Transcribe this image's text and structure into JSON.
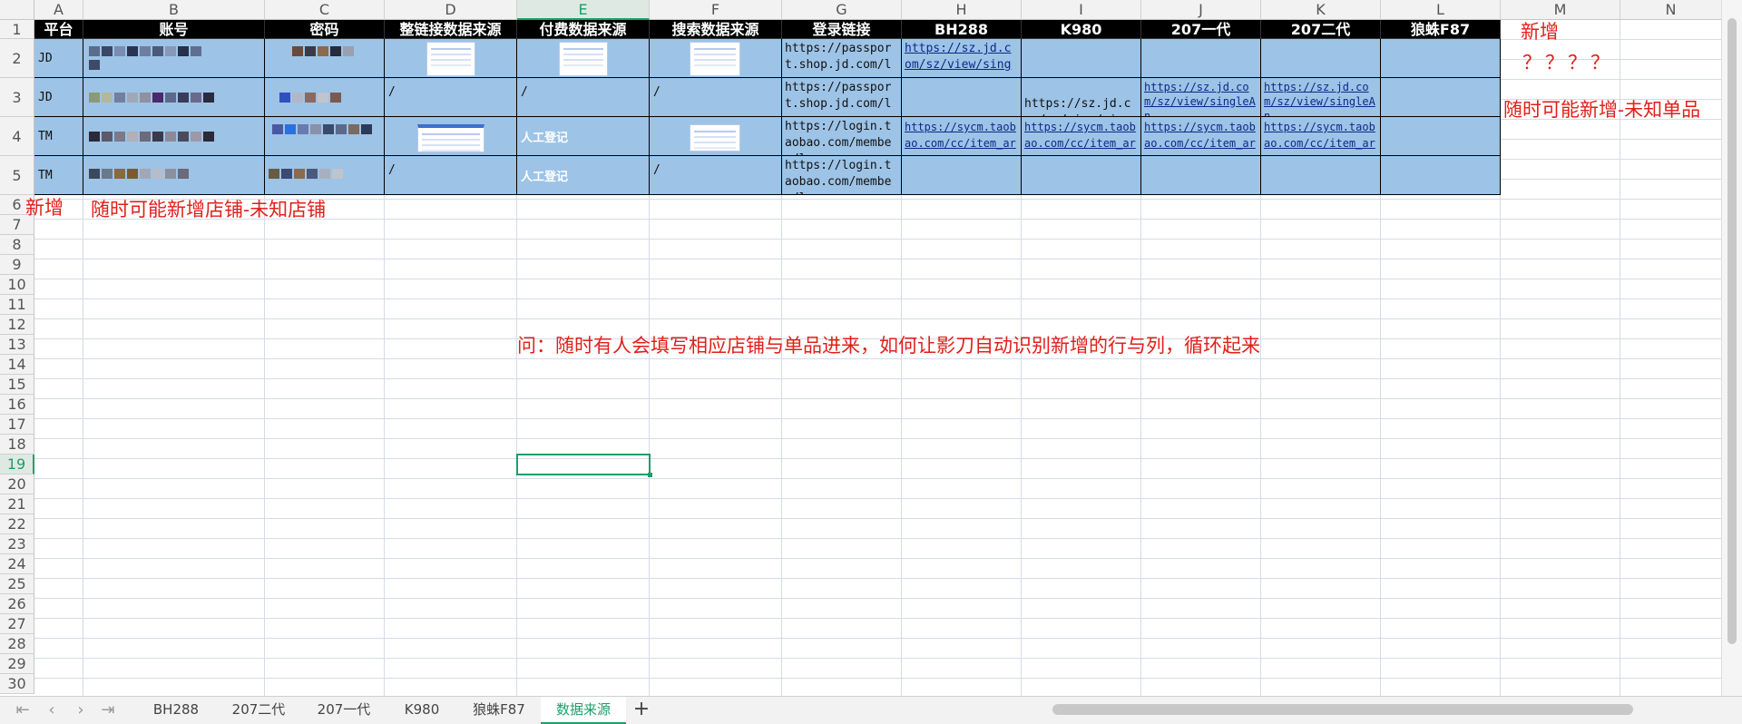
{
  "sheet": {
    "columns": [
      "A",
      "B",
      "C",
      "D",
      "E",
      "F",
      "G",
      "H",
      "I",
      "J",
      "K",
      "L",
      "M",
      "N"
    ],
    "active_column": "E",
    "rows": [
      "1",
      "2",
      "3",
      "4",
      "5",
      "6",
      "7",
      "8",
      "9",
      "10",
      "11",
      "12",
      "13",
      "14",
      "15",
      "16",
      "17",
      "18",
      "19",
      "20",
      "21",
      "22",
      "23",
      "24",
      "25",
      "26",
      "27",
      "28",
      "29",
      "30"
    ],
    "active_row": "19",
    "headers": {
      "platform": "平台",
      "account": "账号",
      "password": "密码",
      "link_source": "整链接数据来源",
      "paid_source": "付费数据来源",
      "search_source": "搜索数据来源",
      "login_link": "登录链接",
      "bh288": "BH288",
      "k980": "K980",
      "gen1": "207一代",
      "gen2": "207二代",
      "f87": "狼蛛F87"
    },
    "data_rows": [
      {
        "platform": "JD",
        "account": "",
        "password": "",
        "link_source": "",
        "paid_source": "",
        "search_source": "",
        "login": "https://passport.shop.jd.com/l",
        "bh288": "https://sz.jd.com/sz/view/sing",
        "k980": "",
        "gen1": "",
        "gen2": "",
        "f87": ""
      },
      {
        "platform": "JD",
        "account": "",
        "password": "",
        "link_source": "/",
        "paid_source": "/",
        "search_source": "/",
        "login": "https://passport.shop.jd.com/l",
        "bh288": "",
        "k980": "https://sz.jd.com/sz/view/sing",
        "gen1": "https://sz.jd.com/sz/view/singleAn",
        "gen2": "https://sz.jd.com/sz/view/singleAn",
        "f87": ""
      },
      {
        "platform": "TM",
        "account": "",
        "password": "",
        "link_source": "",
        "paid_source": "人工登记",
        "search_source": "",
        "login": "https://login.taobao.com/member/lo",
        "bh288": "https://sycm.taobao.com/cc/item_ar",
        "k980": "https://sycm.taobao.com/cc/item_ar",
        "gen1": "https://sycm.taobao.com/cc/item_ar",
        "gen2": "https://sycm.taobao.com/cc/item_ar",
        "f87": ""
      },
      {
        "platform": "TM",
        "account": "",
        "password": "",
        "link_source": "/",
        "paid_source": "人工登记",
        "search_source": "/",
        "login": "https://login.taobao.com/member/lo",
        "bh288": "",
        "k980": "",
        "gen1": "",
        "gen2": "",
        "f87": ""
      }
    ],
    "notes": {
      "new_col_label": "新增",
      "question_marks": "？？？？",
      "new_product_note": "随时可能新增-未知单品",
      "new_row_label": "新增",
      "new_store_note": "随时可能新增店铺-未知店铺",
      "question": "问：随时有人会填写相应店铺与单品进来，如何让影刀自动识别新增的行与列，循环起来"
    }
  },
  "tabs": [
    "BH288",
    "207二代",
    "207一代",
    "K980",
    "狼蛛F87",
    "数据来源"
  ],
  "active_tab": "数据来源",
  "add_sheet_label": "+",
  "colors": {
    "header_bg": "#000000",
    "table_fill": "#9dc3e6",
    "note_red": "#e0201a",
    "accent": "#1e9e6a"
  }
}
